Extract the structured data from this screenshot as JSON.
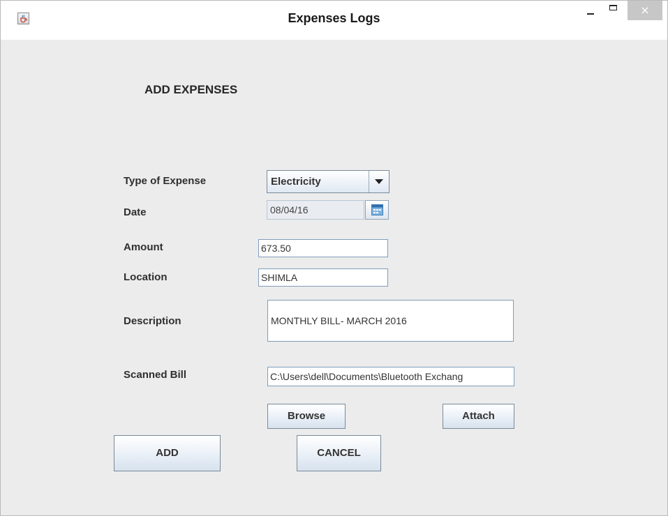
{
  "window": {
    "title": "Expenses Logs",
    "close_glyph": "×"
  },
  "form": {
    "heading": "ADD EXPENSES",
    "type_label": "Type of Expense",
    "type_value": "Electricity",
    "date_label": "Date",
    "date_value": "08/04/16",
    "amount_label": "Amount",
    "amount_value": "673.50",
    "location_label": "Location",
    "location_value": "SHIMLA",
    "description_label": "Description",
    "description_value": "MONTHLY BILL- MARCH 2016",
    "scanned_bill_label": "Scanned Bill",
    "scanned_bill_value": "C:\\Users\\dell\\Documents\\Bluetooth Exchang"
  },
  "buttons": {
    "browse": "Browse",
    "attach": "Attach",
    "add": "ADD",
    "cancel": "CANCEL"
  },
  "icons": {
    "app": "java-cup-icon",
    "calendar": "calendar-icon",
    "dropdown": "chevron-down-icon"
  },
  "colors": {
    "window_bg": "#ececec",
    "field_border": "#7f9db9",
    "button_gradient_end": "#d6e2ee"
  }
}
